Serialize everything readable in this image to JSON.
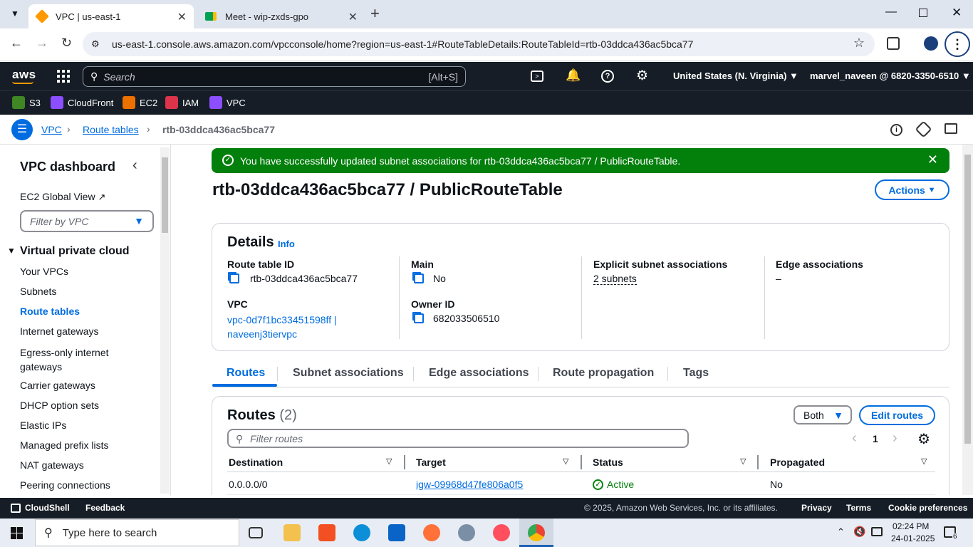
{
  "browser": {
    "tabs": [
      {
        "title": "VPC | us-east-1",
        "active": true
      },
      {
        "title": "Meet - wip-zxds-gpo",
        "active": false
      }
    ],
    "url": "us-east-1.console.aws.amazon.com/vpcconsole/home?region=us-east-1#RouteTableDetails:RouteTableId=rtb-03ddca436ac5bca77"
  },
  "aws_nav": {
    "logo": "aws",
    "search_placeholder": "Search",
    "search_shortcut": "[Alt+S]",
    "region": "United States (N. Virginia)",
    "account": "marvel_naveen @ 6820-3350-6510"
  },
  "favorites": [
    "S3",
    "CloudFront",
    "EC2",
    "IAM",
    "VPC"
  ],
  "breadcrumb": {
    "items": [
      "VPC",
      "Route tables"
    ],
    "current": "rtb-03ddca436ac5bca77"
  },
  "sidebar": {
    "title": "VPC dashboard",
    "global_view": "EC2 Global View",
    "filter_placeholder": "Filter by VPC",
    "section": "Virtual private cloud",
    "items": [
      "Your VPCs",
      "Subnets",
      "Route tables",
      "Internet gateways",
      "Egress-only internet gateways",
      "Carrier gateways",
      "DHCP option sets",
      "Elastic IPs",
      "Managed prefix lists",
      "NAT gateways",
      "Peering connections"
    ],
    "active_item": "Route tables"
  },
  "banner": {
    "message": "You have successfully updated subnet associations for rtb-03ddca436ac5bca77 / PublicRouteTable."
  },
  "page": {
    "title": "rtb-03ddca436ac5bca77 / PublicRouteTable",
    "actions_label": "Actions"
  },
  "details": {
    "heading": "Details",
    "info": "Info",
    "route_table_id_label": "Route table ID",
    "route_table_id": "rtb-03ddca436ac5bca77",
    "main_label": "Main",
    "main": "No",
    "explicit_label": "Explicit subnet associations",
    "explicit": "2 subnets",
    "edge_label": "Edge associations",
    "edge": "–",
    "vpc_label": "VPC",
    "vpc_line1": "vpc-0d7f1bc33451598ff |",
    "vpc_line2": "naveenj3tiervpc",
    "owner_label": "Owner ID",
    "owner": "682033506510"
  },
  "tabs": [
    "Routes",
    "Subnet associations",
    "Edge associations",
    "Route propagation",
    "Tags"
  ],
  "routes": {
    "heading": "Routes",
    "count": "(2)",
    "filter_label": "Both",
    "edit_label": "Edit routes",
    "filter_placeholder": "Filter routes",
    "page": "1",
    "columns": [
      "Destination",
      "Target",
      "Status",
      "Propagated"
    ],
    "rows": [
      {
        "destination": "0.0.0.0/0",
        "target": "igw-09968d47fe806a0f5",
        "status": "Active",
        "propagated": "No"
      }
    ]
  },
  "footer": {
    "cloudshell": "CloudShell",
    "feedback": "Feedback",
    "copyright": "© 2025, Amazon Web Services, Inc. or its affiliates.",
    "links": [
      "Privacy",
      "Terms",
      "Cookie preferences"
    ]
  },
  "taskbar": {
    "search_placeholder": "Type here to search",
    "time": "02:24 PM",
    "date": "24-01-2025",
    "notifications": "6"
  },
  "colors": {
    "success": "#037f0c",
    "link": "#006ce0",
    "nav_bg": "#161d26"
  }
}
